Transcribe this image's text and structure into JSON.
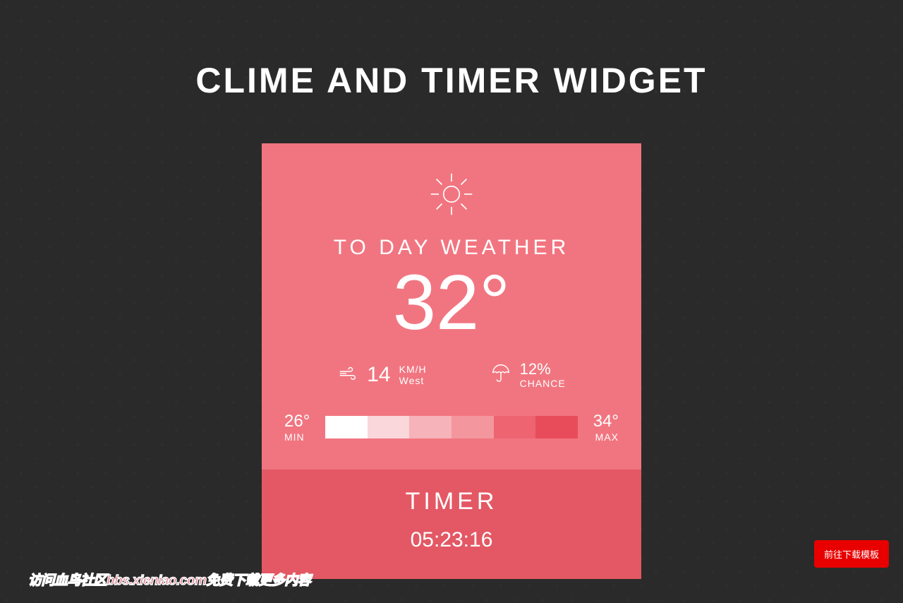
{
  "page": {
    "title": "CLIME AND TIMER WIDGET"
  },
  "weather": {
    "today_label": "TO DAY WEATHER",
    "temperature": "32°",
    "wind": {
      "value": "14",
      "unit": "KM/H",
      "direction": "West"
    },
    "rain": {
      "percent": "12%",
      "label": "CHANCE"
    },
    "min": {
      "temp": "26°",
      "label": "MIN"
    },
    "max": {
      "temp": "34°",
      "label": "MAX"
    }
  },
  "timer": {
    "title": "TIMER",
    "value": "05:23:16"
  },
  "download_button": "前往下载模板",
  "watermark": "访问血鸟社区bbs.xieniao.com免费下载更多内容"
}
